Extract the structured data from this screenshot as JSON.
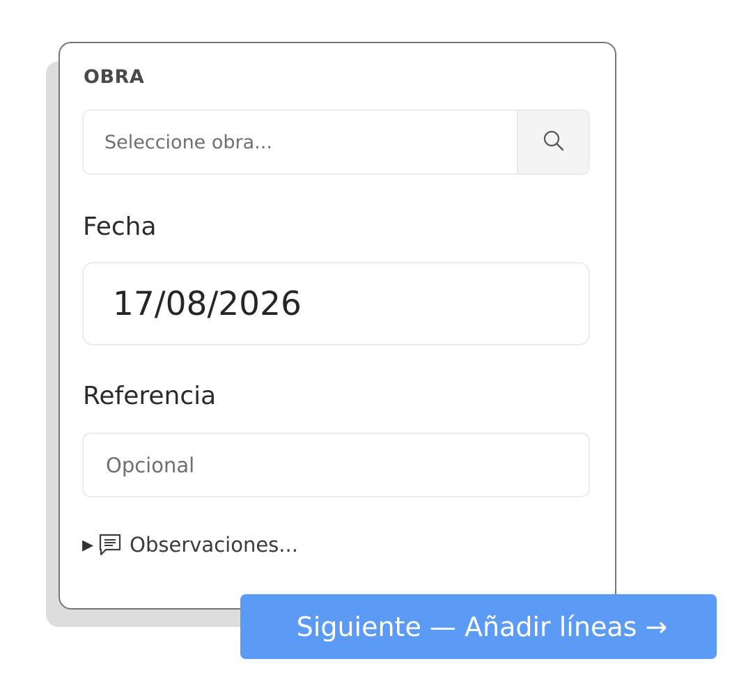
{
  "form": {
    "obra_label": "OBRA",
    "obra_placeholder": "Seleccione obra...",
    "search_icon": "search-icon",
    "fecha_label": "Fecha",
    "fecha_value": "17/08/2026",
    "referencia_label": "Referencia",
    "referencia_placeholder": "Opcional",
    "observaciones_caret": "▶",
    "observaciones_icon": "comment-icon",
    "observaciones_label": "Observaciones..."
  },
  "actions": {
    "next_label": "Siguiente — Añadir líneas →"
  },
  "colors": {
    "primary_button": "#5b9bf5",
    "card_border": "#757575"
  }
}
